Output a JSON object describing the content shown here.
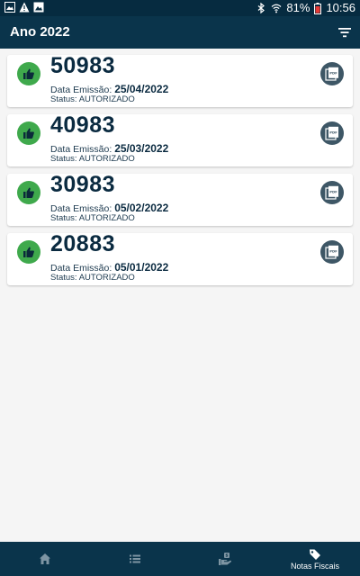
{
  "status_bar": {
    "left_icons": [
      "image-notification-icon",
      "warning-icon",
      "photo-notification-icon"
    ],
    "battery_percent": "81%",
    "time": "10:56"
  },
  "appbar": {
    "title": "Ano 2022",
    "filter_icon": "filter-icon"
  },
  "notes": [
    {
      "number": "50983",
      "date_label": "Data Emissão:",
      "date": "25/04/2022",
      "status_label": "Status:",
      "status": "AUTORIZADO"
    },
    {
      "number": "40983",
      "date_label": "Data Emissão:",
      "date": "25/03/2022",
      "status_label": "Status:",
      "status": "AUTORIZADO"
    },
    {
      "number": "30983",
      "date_label": "Data Emissão:",
      "date": "05/02/2022",
      "status_label": "Status:",
      "status": "AUTORIZADO"
    },
    {
      "number": "20883",
      "date_label": "Data Emissão:",
      "date": "05/01/2022",
      "status_label": "Status:",
      "status": "AUTORIZADO"
    }
  ],
  "bottom_nav": {
    "items": [
      {
        "icon": "home-icon",
        "label": ""
      },
      {
        "icon": "list-icon",
        "label": ""
      },
      {
        "icon": "hand-coin-icon",
        "label": ""
      },
      {
        "icon": "tag-icon",
        "label": "Notas Fiscais",
        "active": true
      }
    ]
  },
  "colors": {
    "primary": "#0a344b",
    "approved": "#3fa94c",
    "pdf_button": "#3e5766",
    "background": "#f5f5f5"
  }
}
